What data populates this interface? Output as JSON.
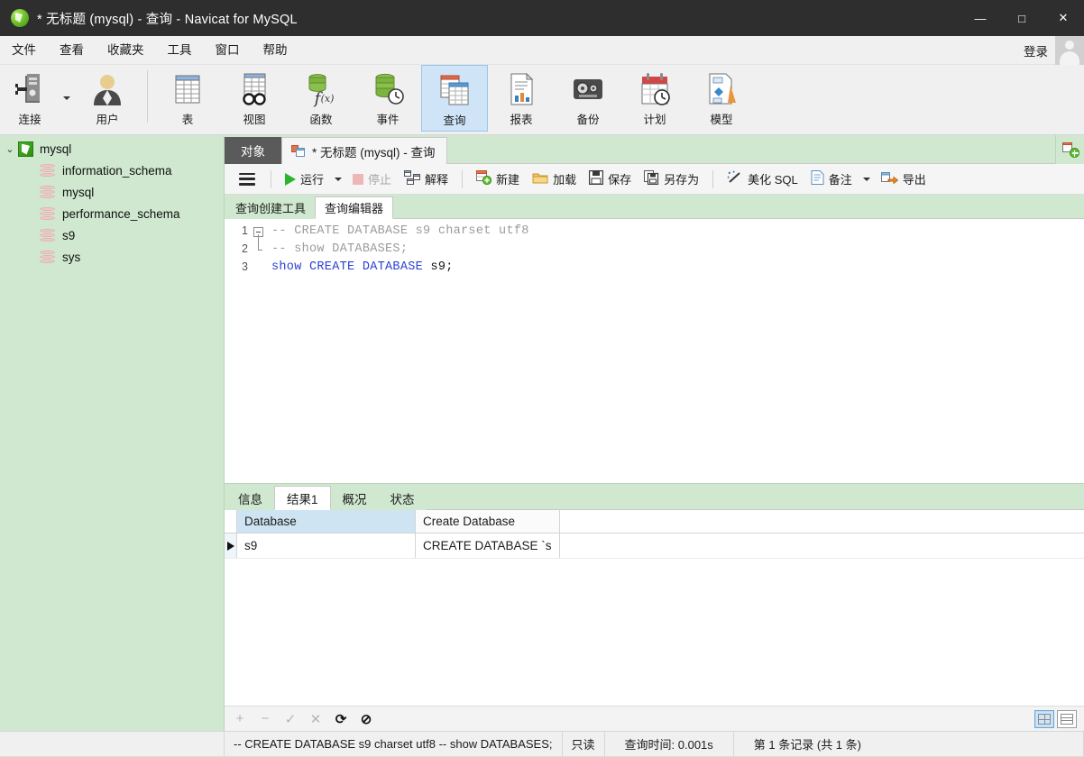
{
  "window": {
    "title": "* 无标题 (mysql) - 查询 - Navicat for MySQL",
    "logo_icon": "navicat-logo-icon",
    "minimize_icon": "minimize-icon",
    "maximize_icon": "maximize-icon",
    "close_icon": "close-icon",
    "minimize_glyph": "―",
    "maximize_glyph": "□",
    "close_glyph": "✕"
  },
  "menubar": {
    "items": [
      {
        "label": "文件"
      },
      {
        "label": "查看"
      },
      {
        "label": "收藏夹"
      },
      {
        "label": "工具"
      },
      {
        "label": "窗口"
      },
      {
        "label": "帮助"
      }
    ],
    "login_label": "登录",
    "avatar_icon": "user-avatar-icon"
  },
  "toolbar": {
    "items": [
      {
        "label": "连接",
        "icon": "connection-icon",
        "has_dropdown": true,
        "active": false
      },
      {
        "label": "用户",
        "icon": "user-icon",
        "has_dropdown": false,
        "active": false
      },
      {
        "label": "表",
        "icon": "table-icon",
        "has_dropdown": false,
        "active": false
      },
      {
        "label": "视图",
        "icon": "view-icon",
        "has_dropdown": false,
        "active": false
      },
      {
        "label": "函数",
        "icon": "function-icon",
        "has_dropdown": false,
        "active": false
      },
      {
        "label": "事件",
        "icon": "event-icon",
        "has_dropdown": false,
        "active": false
      },
      {
        "label": "查询",
        "icon": "query-icon",
        "has_dropdown": false,
        "active": true
      },
      {
        "label": "报表",
        "icon": "report-icon",
        "has_dropdown": false,
        "active": false
      },
      {
        "label": "备份",
        "icon": "backup-icon",
        "has_dropdown": false,
        "active": false
      },
      {
        "label": "计划",
        "icon": "schedule-icon",
        "has_dropdown": false,
        "active": false
      },
      {
        "label": "模型",
        "icon": "model-icon",
        "has_dropdown": false,
        "active": false
      }
    ]
  },
  "sidebar": {
    "connection": {
      "label": "mysql",
      "icon": "connection-green-icon",
      "expanded": true,
      "chevron": "⌄"
    },
    "databases": [
      {
        "label": "information_schema",
        "icon": "database-icon"
      },
      {
        "label": "mysql",
        "icon": "database-icon"
      },
      {
        "label": "performance_schema",
        "icon": "database-icon"
      },
      {
        "label": "s9",
        "icon": "database-icon"
      },
      {
        "label": "sys",
        "icon": "database-icon"
      }
    ]
  },
  "tabstrip": {
    "object_tab": "对象",
    "query_tab": "* 无标题 (mysql) - 查询",
    "query_tab_icon": "query-tab-icon",
    "add_tab_icon": "new-query-tab-icon"
  },
  "query_toolbar": {
    "menu_icon": "hamburger-menu-icon",
    "buttons": [
      {
        "label": "运行",
        "icon": "run-play-icon",
        "disabled": false,
        "dropdown": true
      },
      {
        "label": "停止",
        "icon": "stop-icon",
        "disabled": true,
        "dropdown": false
      },
      {
        "label": "解释",
        "icon": "explain-icon",
        "disabled": false,
        "dropdown": false
      },
      {
        "label": "新建",
        "icon": "new-query-icon",
        "disabled": false,
        "dropdown": false
      },
      {
        "label": "加载",
        "icon": "load-folder-icon",
        "disabled": false,
        "dropdown": false
      },
      {
        "label": "保存",
        "icon": "save-disk-icon",
        "disabled": false,
        "dropdown": false
      },
      {
        "label": "另存为",
        "icon": "save-as-icon",
        "disabled": false,
        "dropdown": false
      },
      {
        "label": "美化 SQL",
        "icon": "beautify-sql-icon",
        "disabled": false,
        "dropdown": false
      },
      {
        "label": "备注",
        "icon": "comment-icon",
        "disabled": false,
        "dropdown": true
      },
      {
        "label": "导出",
        "icon": "export-icon",
        "disabled": false,
        "dropdown": false
      }
    ]
  },
  "editor_subtabs": [
    {
      "label": "查询创建工具",
      "active": false
    },
    {
      "label": "查询编辑器",
      "active": true
    }
  ],
  "editor": {
    "lines": [
      {
        "no": "1",
        "fold": "start",
        "segments": [
          {
            "text": "-- CREATE DATABASE s9 charset utf8",
            "style": "comment"
          }
        ]
      },
      {
        "no": "2",
        "fold": "end",
        "segments": [
          {
            "text": "-- show DATABASES;",
            "style": "comment"
          }
        ]
      },
      {
        "no": "3",
        "fold": "none",
        "segments": [
          {
            "text": "show CREATE DATABASE ",
            "style": "keyword"
          },
          {
            "text": "s9;",
            "style": "identifier"
          }
        ]
      }
    ]
  },
  "result_tabs": [
    {
      "label": "信息",
      "active": false
    },
    {
      "label": "结果1",
      "active": true
    },
    {
      "label": "概况",
      "active": false
    },
    {
      "label": "状态",
      "active": false
    }
  ],
  "result_grid": {
    "columns": [
      {
        "label": "Database",
        "selected": true,
        "width": 198
      },
      {
        "label": "Create Database",
        "selected": false,
        "width": 160
      }
    ],
    "rows": [
      {
        "current": true,
        "cells": [
          "s9",
          "CREATE DATABASE `s"
        ]
      }
    ],
    "row_marker_icon": "current-row-arrow-icon"
  },
  "grid_footer": {
    "buttons": [
      {
        "icon": "add-record-icon",
        "glyph": "+",
        "disabled": true
      },
      {
        "icon": "delete-record-icon",
        "glyph": "−",
        "disabled": true
      },
      {
        "icon": "apply-change-icon",
        "glyph": "✓",
        "disabled": true
      },
      {
        "icon": "cancel-change-icon",
        "glyph": "✕",
        "disabled": true
      },
      {
        "icon": "refresh-icon",
        "glyph": "⟳",
        "disabled": false
      },
      {
        "icon": "stop-loading-icon",
        "glyph": "⊘",
        "disabled": false
      }
    ],
    "view_modes": [
      {
        "icon": "grid-view-icon",
        "active": true
      },
      {
        "icon": "form-view-icon",
        "active": false
      }
    ]
  },
  "statusbar": {
    "query_text": "-- CREATE DATABASE s9 charset utf8 -- show DATABASES;",
    "readonly": "只读",
    "query_time": "查询时间: 0.001s",
    "record_count": "第 1 条记录 (共 1 条)"
  }
}
